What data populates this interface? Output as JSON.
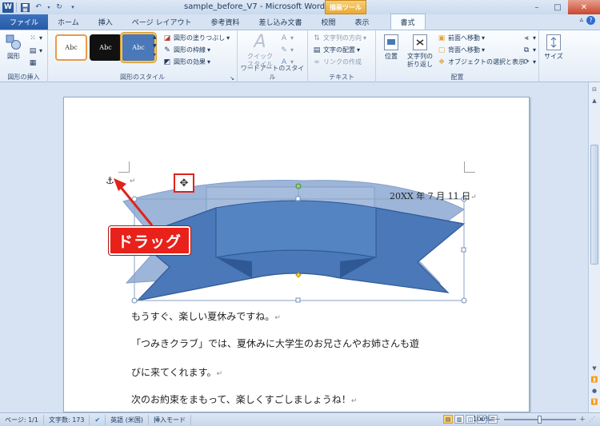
{
  "window": {
    "title": "sample_before_V7 - Microsoft Word",
    "contextual_tab": "描画ツール",
    "app_icon": "W",
    "minimize": "–",
    "maximize": "□",
    "close": "✕"
  },
  "tabs": [
    "ファイル",
    "ホーム",
    "挿入",
    "ページ レイアウト",
    "参考資料",
    "差し込み文書",
    "校閲",
    "表示",
    "書式"
  ],
  "active_tab": "書式",
  "ribbon": {
    "insert_shapes": {
      "label": "図形の挿入",
      "shapes_button": "図形"
    },
    "shape_styles": {
      "label": "図形のスタイル",
      "presets": [
        "Abc",
        "Abc",
        "Abc"
      ],
      "fill": "図形の塗りつぶし",
      "outline": "図形の枠線",
      "effects": "図形の効果"
    },
    "wordart": {
      "label": "ワードアートのスタイル",
      "quick_style_1": "クイック",
      "quick_style_2": "スタイル"
    },
    "text": {
      "label": "テキスト",
      "direction": "文字列の方向",
      "align": "文字の配置",
      "link": "リンクの作成"
    },
    "arrange": {
      "label": "配置",
      "position": "位置",
      "wrap_1": "文字列の",
      "wrap_2": "折り返し",
      "bring_forward": "前面へ移動",
      "send_backward": "背面へ移動",
      "selection_pane": "オブジェクトの選択と表示"
    },
    "size": {
      "label": "サイズ"
    }
  },
  "document": {
    "date": "20XX 年 7 月 11 日",
    "lines": [
      "もうすぐ、楽しい夏休みですね。",
      "「つみきクラブ」では、夏休みに大学生のお兄さんやお姉さんも遊",
      "びに来てくれます。",
      "次のお約束をまもって、楽しくすごしましょうね！"
    ],
    "paragraph_mark": "↵",
    "callout": "ドラッグ",
    "anchor_icon": "⚓",
    "move_icon": "✥"
  },
  "statusbar": {
    "page": "ページ: 1/1",
    "words": "文字数: 173",
    "language": "英語 (米国)",
    "mode": "挿入モード",
    "zoom": "100%",
    "zoom_minus": "－",
    "zoom_plus": "＋"
  },
  "colors": {
    "ribbon_shape": "#4a78b8",
    "ribbon_shape_back": "#7d9dcb",
    "callout": "#e8211a",
    "drawing_tools": "#e9a935"
  }
}
